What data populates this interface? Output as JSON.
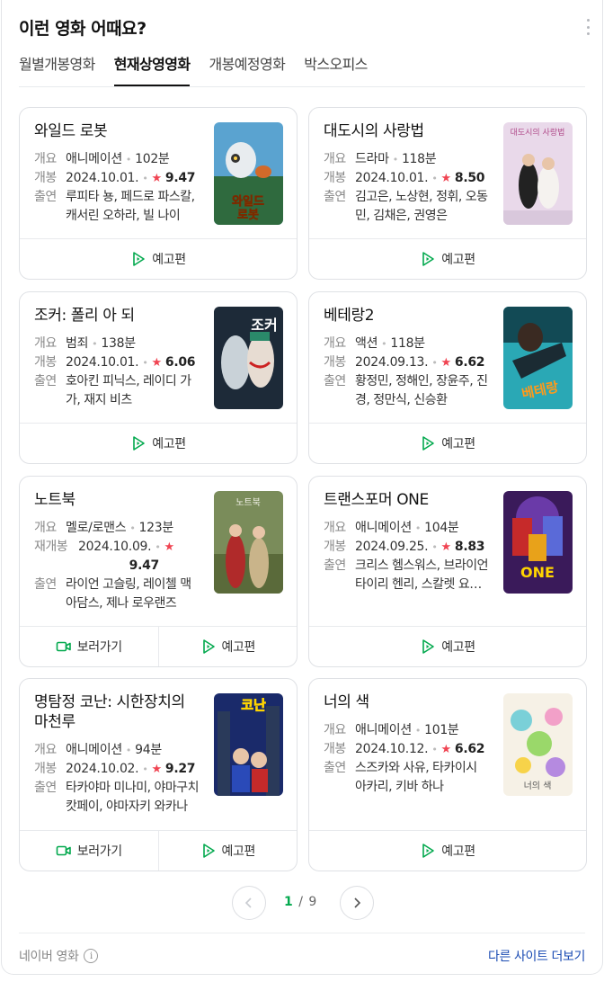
{
  "header": {
    "title": "이런 영화 어때요?"
  },
  "tabs": [
    {
      "label": "월별개봉영화"
    },
    {
      "label": "현재상영영화"
    },
    {
      "label": "개봉예정영화"
    },
    {
      "label": "박스오피스"
    }
  ],
  "labels": {
    "genre": "개요",
    "release": "개봉",
    "rerelease": "재개봉",
    "cast": "출연",
    "trailer": "예고편",
    "watch": "보러가기"
  },
  "movies": [
    {
      "title": "와일드 로봇",
      "genre": "애니메이션",
      "runtime": "102분",
      "date": "2024.10.01.",
      "score": "9.47",
      "cast": "루피타 뇽, 페드로 파스칼, 캐서린 오하라, 빌 나이",
      "poster_text": "와일드\n로봇"
    },
    {
      "title": "대도시의 사랑법",
      "genre": "드라마",
      "runtime": "118분",
      "date": "2024.10.01.",
      "score": "8.50",
      "cast": "김고은, 노상현, 정휘, 오동민, 김채은, 권영은",
      "poster_text": "대도시의 사랑법"
    },
    {
      "title": "조커: 폴리 아 되",
      "genre": "범죄",
      "runtime": "138분",
      "date": "2024.10.01.",
      "score": "6.06",
      "cast": "호아킨 피닉스, 레이디 가가, 재지 비츠",
      "poster_text": "조커"
    },
    {
      "title": "베테랑2",
      "genre": "액션",
      "runtime": "118분",
      "date": "2024.09.13.",
      "score": "6.62",
      "cast": "황정민, 정해인, 장윤주, 진경, 정만식, 신승환",
      "poster_text": "베테랑"
    },
    {
      "title": "노트북",
      "genre": "멜로/로맨스",
      "runtime": "123분",
      "date": "2024.10.09.",
      "score": "9.47",
      "cast": "라이언 고슬링, 레이첼 맥아담스, 제나 로우랜즈",
      "poster_text": "노트북"
    },
    {
      "title": "트랜스포머 ONE",
      "genre": "애니메이션",
      "runtime": "104분",
      "date": "2024.09.25.",
      "score": "8.83",
      "cast": "크리스 헴스워스, 브라이언 타이리 헨리, 스칼렛 요한슨",
      "poster_text": "ONE"
    },
    {
      "title": "명탐정 코난: 시한장치의 마천루",
      "genre": "애니메이션",
      "runtime": "94분",
      "date": "2024.10.02.",
      "score": "9.27",
      "cast": "타카야마 미나미, 야마구치 캇페이, 야마자키 와카나",
      "poster_text": "코난"
    },
    {
      "title": "너의 색",
      "genre": "애니메이션",
      "runtime": "101분",
      "date": "2024.10.12.",
      "score": "6.62",
      "cast": "스즈카와 사유, 타카이시 아카리, 키바 하나",
      "poster_text": "너의 색"
    }
  ],
  "pagination": {
    "current": "1",
    "separator": "/",
    "total": "9"
  },
  "footer": {
    "source": "네이버 영화",
    "info": "i",
    "more": "다른 사이트 더보기"
  },
  "colors": {
    "accent_green": "#03a94e",
    "star_red": "#f04452",
    "link_blue": "#1a4bb3"
  }
}
